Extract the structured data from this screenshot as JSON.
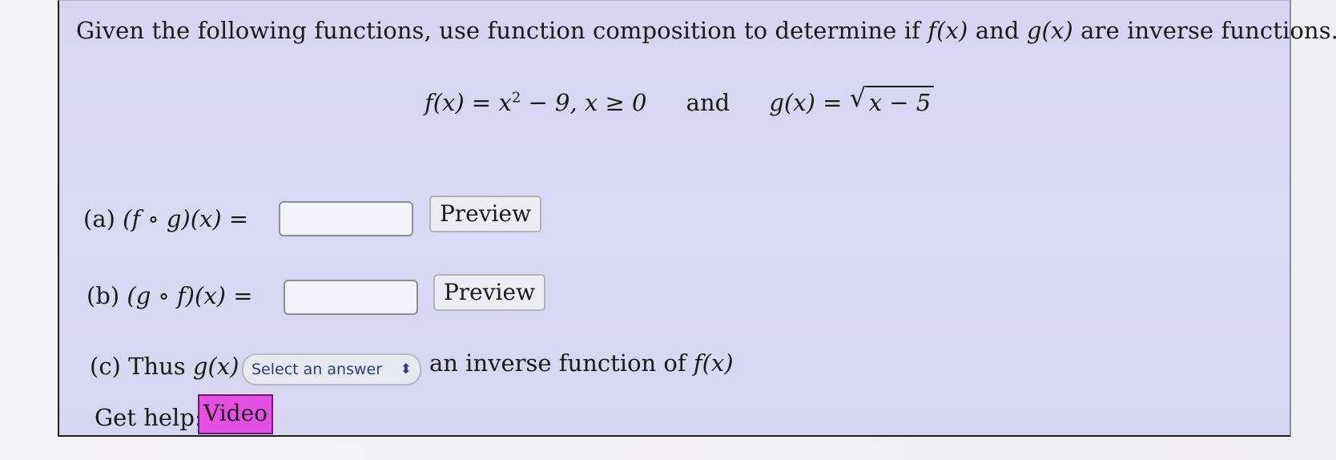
{
  "question": {
    "text_before_f": "Given the following functions, use function composition to determine if ",
    "f_of_x": "f(x)",
    "text_and": " and ",
    "g_of_x": "g(x)",
    "text_after": " are inverse functions."
  },
  "formula": {
    "f_def": "f(x) = x",
    "f_exp": "2",
    "f_rest": " − 9, x ≥ 0",
    "and_word": "and",
    "g_def": "g(x) = ",
    "g_radicand": "x − 5"
  },
  "parts": {
    "a": {
      "label": "(a) ",
      "expr": "(f ∘ g)(x)",
      "equals": " =",
      "input_value": "",
      "preview_label": "Preview"
    },
    "b": {
      "label": "(b) ",
      "expr": "(g ∘ f)(x)",
      "equals": " =",
      "input_value": "",
      "preview_label": "Preview"
    },
    "c": {
      "label": "(c) Thus ",
      "expr": "g(x)",
      "select_value": "Select an answer",
      "after_text": "an inverse function of ",
      "after_expr": "f(x)"
    }
  },
  "help": {
    "label": "Get help:",
    "video_label": "Video"
  },
  "icons": {
    "select_chevron": "chevron-updown-icon"
  },
  "colors": {
    "panel_bg": "#d8d4f1",
    "video_bg": "#e64fe4",
    "select_text": "#2a3f73"
  }
}
